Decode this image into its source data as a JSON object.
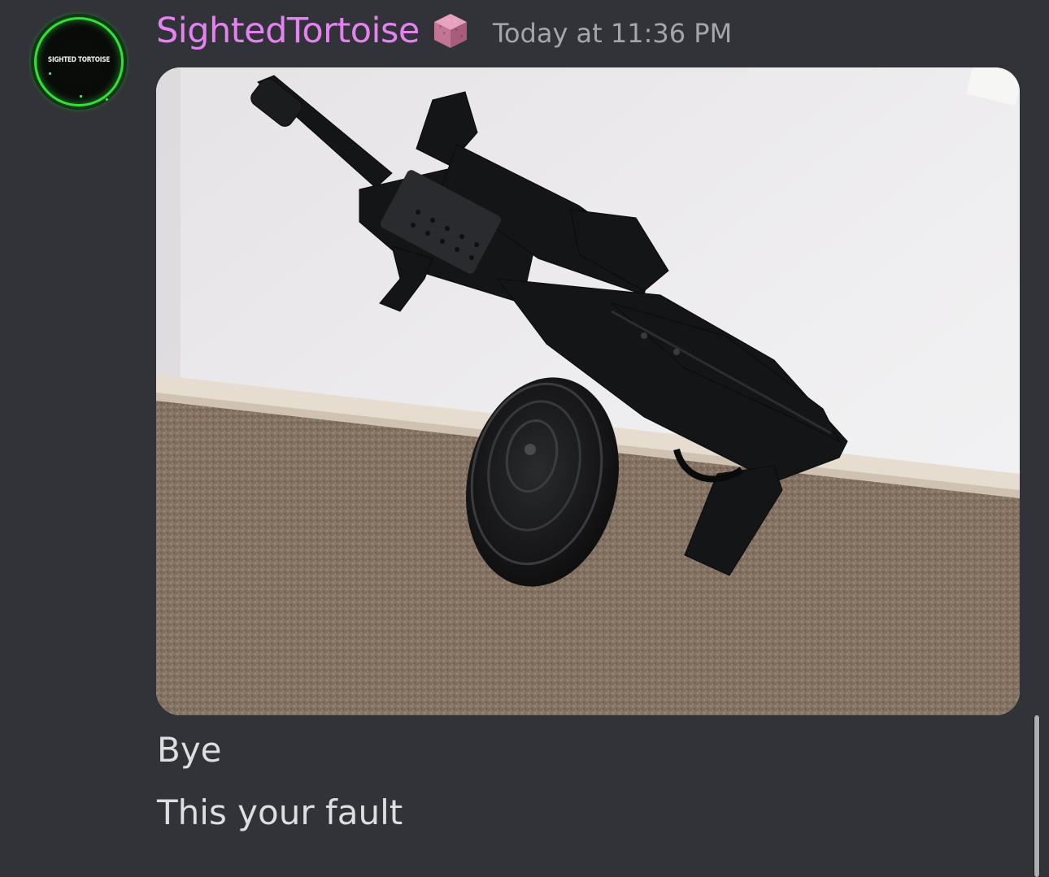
{
  "message": {
    "author": {
      "username": "SightedTortoise",
      "avatar_text": "SIGHTED TORTOISE",
      "username_color": "#e482f0",
      "role_icon": "pink-cube-icon"
    },
    "timestamp": "Today at 11:36 PM",
    "attachment": {
      "type": "image",
      "subject": "firearm-photo"
    },
    "lines": [
      "Bye",
      "This your fault"
    ]
  },
  "colors": {
    "background": "#313338",
    "text": "#dcdee2",
    "timestamp": "#a3a6ad",
    "avatar_ring": "#34e03a"
  }
}
